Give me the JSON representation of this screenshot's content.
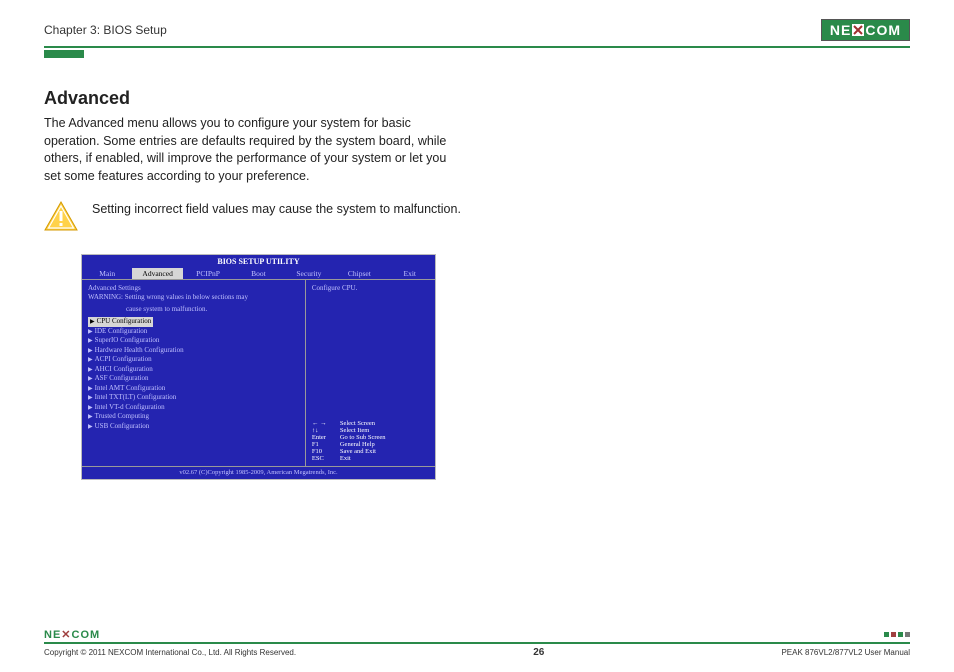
{
  "header": {
    "chapter": "Chapter 3: BIOS Setup",
    "logo_left": "NE",
    "logo_right": "COM"
  },
  "section": {
    "title": "Advanced",
    "body": "The Advanced menu allows you to configure your system for basic operation. Some entries are defaults required by the system board, while others, if enabled, will improve the performance of your system or let you set some features according to your preference."
  },
  "warning_text": "Setting incorrect field values may cause the system to malfunction.",
  "bios": {
    "title": "BIOS SETUP UTILITY",
    "tabs": [
      "Main",
      "Advanced",
      "PCIPnP",
      "Boot",
      "Security",
      "Chipset",
      "Exit"
    ],
    "settings_label": "Advanced Settings",
    "warning_l1": "WARNING:  Setting wrong values in below sections may",
    "warning_l2": "cause system to malfunction.",
    "items": [
      "CPU Configuration",
      "IDE Configuration",
      "SuperIO Configuration",
      "Hardware Health Configuration",
      "ACPI Configuration",
      "AHCI Configuration",
      "ASF Configuration",
      "Intel AMT Configuration",
      "Intel TXT(LT) Configuration",
      "Intel VT-d Configuration",
      "Trusted Computing",
      "USB Configuration"
    ],
    "help_top": "Configure CPU.",
    "keys": [
      {
        "k": "← →",
        "v": "Select Screen"
      },
      {
        "k": "↑↓",
        "v": "Select Item"
      },
      {
        "k": "Enter",
        "v": "Go to Sub Screen"
      },
      {
        "k": "F1",
        "v": "General Help"
      },
      {
        "k": "F10",
        "v": "Save and Exit"
      },
      {
        "k": "ESC",
        "v": "Exit"
      }
    ],
    "footer": "v02.67 (C)Copyright 1985-2009, American Megatrends, Inc."
  },
  "footer": {
    "logo_left": "NE",
    "logo_right": "COM",
    "copyright": "Copyright © 2011 NEXCOM International Co., Ltd. All Rights Reserved.",
    "page": "26",
    "manual": "PEAK 876VL2/877VL2 User Manual"
  }
}
